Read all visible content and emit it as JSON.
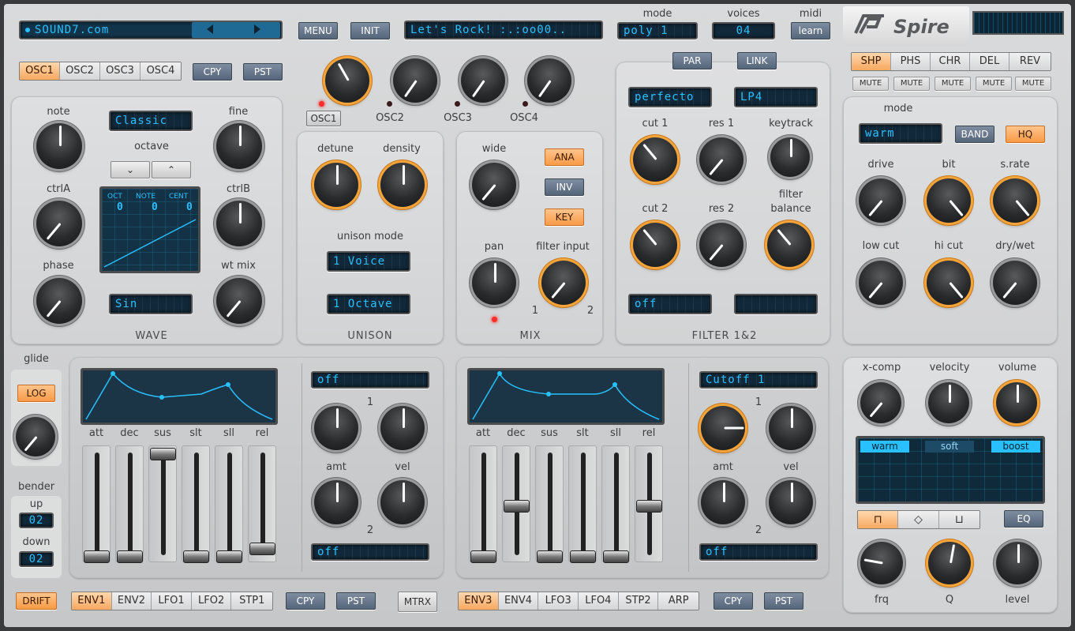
{
  "header": {
    "preset_name": "SOUND7.com",
    "menu": "MENU",
    "init": "INIT",
    "patch_name": "Let's Rock! :.:oo00..",
    "mode_label": "mode",
    "mode_value": "poly 1",
    "voices_label": "voices",
    "voices_value": "04",
    "midi_label": "midi",
    "midi_button": "learn",
    "logo": "Spire"
  },
  "osc_tabs": [
    "OSC1",
    "OSC2",
    "OSC3",
    "OSC4"
  ],
  "cpy": "CPY",
  "pst": "PST",
  "osc_level_labels": [
    "OSC1",
    "OSC2",
    "OSC3",
    "OSC4"
  ],
  "wave": {
    "note": "note",
    "fine": "fine",
    "ctrlA": "ctrlA",
    "ctrlB": "ctrlB",
    "phase": "phase",
    "wtmix": "wt mix",
    "octave": "octave",
    "osc_type": "Classic",
    "wave_shape": "Sin",
    "disp_oct": "OCT",
    "disp_note": "NOTE",
    "disp_cent": "CENT",
    "oct_val": "0",
    "note_val": "0",
    "cent_val": "0",
    "section": "WAVE"
  },
  "unison": {
    "detune": "detune",
    "density": "density",
    "mode_label": "unison mode",
    "voices": "1 Voice",
    "octave": "1 Octave",
    "section": "UNISON"
  },
  "mix": {
    "wide": "wide",
    "pan": "pan",
    "filter_input": "filter input",
    "ana": "ANA",
    "inv": "INV",
    "key": "KEY",
    "in1": "1",
    "in2": "2",
    "section": "MIX"
  },
  "filter": {
    "par": "PAR",
    "link": "LINK",
    "type1": "perfecto",
    "type2": "LP4",
    "cut1": "cut 1",
    "res1": "res 1",
    "keytrack": "keytrack",
    "cut2": "cut 2",
    "res2": "res 2",
    "balance1": "filter",
    "balance2": "balance",
    "mode": "off",
    "mode2": "",
    "section": "FILTER 1&2"
  },
  "fx_tabs": [
    "SHP",
    "PHS",
    "CHR",
    "DEL",
    "REV"
  ],
  "mute": "MUTE",
  "shaper": {
    "mode_label": "mode",
    "mode_value": "warm",
    "band": "BAND",
    "hq": "HQ",
    "drive": "drive",
    "bit": "bit",
    "srate": "s.rate",
    "lowcut": "low cut",
    "hicut": "hi cut",
    "drywet": "dry/wet"
  },
  "eq": {
    "xcomp": "x-comp",
    "velocity": "velocity",
    "volume": "volume",
    "modes": [
      "warm",
      "soft",
      "boost"
    ],
    "eq": "EQ",
    "frq": "frq",
    "q": "Q",
    "level": "level"
  },
  "left": {
    "glide": "glide",
    "log": "LOG",
    "bender": "bender",
    "up": "up",
    "up_val": "02",
    "down": "down",
    "down_val": "02",
    "drift": "DRIFT"
  },
  "env1": {
    "labels": [
      "att",
      "dec",
      "sus",
      "slt",
      "sll",
      "rel"
    ],
    "dest1": "off",
    "dest2": "off",
    "amt": "amt",
    "vel": "vel",
    "n1": "1",
    "n2": "2"
  },
  "env2": {
    "labels": [
      "att",
      "dec",
      "sus",
      "slt",
      "sll",
      "rel"
    ],
    "dest1": "Cutoff 1",
    "dest2": "off",
    "amt": "amt",
    "vel": "vel",
    "n1": "1",
    "n2": "2"
  },
  "mod_tabs_left": [
    "ENV1",
    "ENV2",
    "LFO1",
    "LFO2",
    "STP1"
  ],
  "mod_tabs_right": [
    "ENV3",
    "ENV4",
    "LFO3",
    "LFO4",
    "STP2",
    "ARP"
  ],
  "mtrx": "MTRX"
}
